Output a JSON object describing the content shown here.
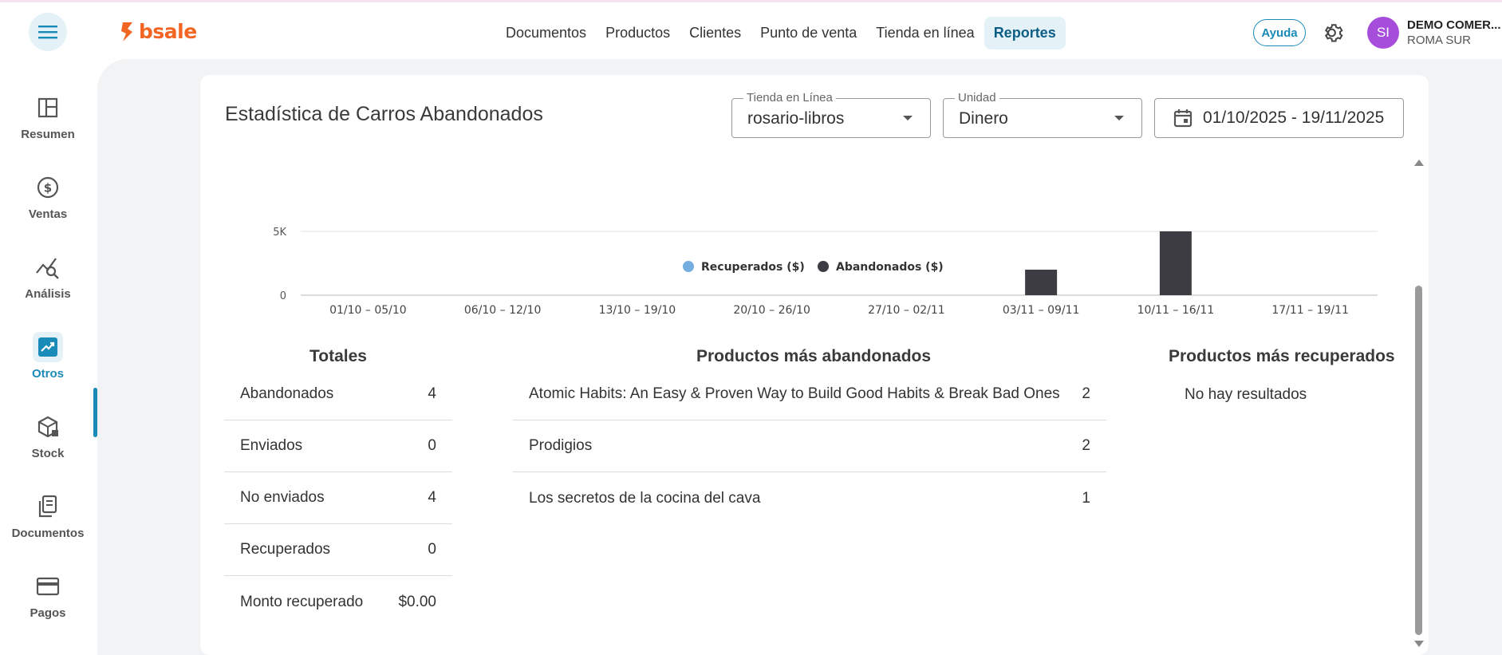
{
  "app": {
    "logo": "bsale"
  },
  "nav": {
    "items": [
      {
        "label": "Documentos",
        "active": false
      },
      {
        "label": "Productos",
        "active": false
      },
      {
        "label": "Clientes",
        "active": false
      },
      {
        "label": "Punto de venta",
        "active": false
      },
      {
        "label": "Tienda en línea",
        "active": false
      },
      {
        "label": "Reportes",
        "active": true
      }
    ]
  },
  "header": {
    "help_label": "Ayuda",
    "avatar_initials": "SI",
    "company_name": "DEMO COMER...",
    "company_branch": "ROMA SUR"
  },
  "sidebar": {
    "items": [
      {
        "label": "Resumen",
        "icon": "layout-icon"
      },
      {
        "label": "Ventas",
        "icon": "dollar-icon"
      },
      {
        "label": "Análisis",
        "icon": "analytics-icon"
      },
      {
        "label": "Otros",
        "icon": "trend-icon",
        "active": true
      },
      {
        "label": "Stock",
        "icon": "box-icon"
      },
      {
        "label": "Documentos",
        "icon": "document-icon"
      },
      {
        "label": "Pagos",
        "icon": "card-icon"
      }
    ]
  },
  "report": {
    "title": "Estadística de Carros Abandonados",
    "store_filter": {
      "label": "Tienda en Línea",
      "value": "rosario-libros"
    },
    "unit_filter": {
      "label": "Unidad",
      "value": "Dinero"
    },
    "date_range": "01/10/2025 - 19/11/2025"
  },
  "chart_data": {
    "type": "bar",
    "categories": [
      "01/10 – 05/10",
      "06/10 – 12/10",
      "13/10 – 19/10",
      "20/10 – 26/10",
      "27/10 – 02/11",
      "03/11 – 09/11",
      "10/11 – 16/11",
      "17/11 – 19/11"
    ],
    "series": [
      {
        "name": "Recuperados ($)",
        "color": "#74aee0",
        "values": [
          0,
          0,
          0,
          0,
          0,
          0,
          0,
          0
        ]
      },
      {
        "name": "Abandonados ($)",
        "color": "#3d3c42",
        "values": [
          0,
          0,
          0,
          0,
          0,
          2000,
          5000,
          0
        ]
      }
    ],
    "y_ticks": [
      "0",
      "5K"
    ],
    "ylim": [
      0,
      5000
    ],
    "legend_position": "bottom"
  },
  "totals": {
    "title": "Totales",
    "rows": [
      {
        "label": "Abandonados",
        "value": "4"
      },
      {
        "label": "Enviados",
        "value": "0"
      },
      {
        "label": "No enviados",
        "value": "4"
      },
      {
        "label": "Recuperados",
        "value": "0"
      },
      {
        "label": "Monto recuperado",
        "value": "$0.00"
      }
    ]
  },
  "abandoned_products": {
    "title": "Productos más abandonados",
    "rows": [
      {
        "label": "Atomic Habits: An Easy & Proven Way to Build Good Habits & Break Bad Ones",
        "value": "2"
      },
      {
        "label": "Prodigios",
        "value": "2"
      },
      {
        "label": "Los secretos de la cocina del cava",
        "value": "1"
      }
    ]
  },
  "recovered_products": {
    "title": "Productos más recuperados",
    "empty_message": "No hay resultados"
  }
}
